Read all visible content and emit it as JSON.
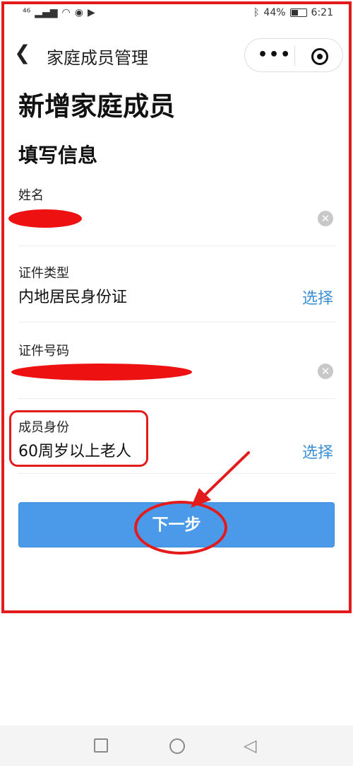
{
  "status": {
    "network": "⁴⁶",
    "battery_percent": "44%",
    "time": "6:21"
  },
  "nav": {
    "title": "家庭成员管理",
    "back_icon": "chevron-left-icon",
    "more_label": "•••"
  },
  "page": {
    "heading": "新增家庭成员",
    "section_heading": "填写信息"
  },
  "fields": {
    "name": {
      "label": "姓名"
    },
    "id_type": {
      "label": "证件类型",
      "value": "内地居民身份证",
      "action": "选择"
    },
    "id_number": {
      "label": "证件号码"
    },
    "member_identity": {
      "label": "成员身份",
      "value": "60周岁以上老人",
      "action": "选择"
    }
  },
  "button": {
    "next_label": "下一步"
  },
  "colors": {
    "accent": "#3b8fd5",
    "button": "#4a9ae9",
    "annotation": "#e41b1b"
  }
}
